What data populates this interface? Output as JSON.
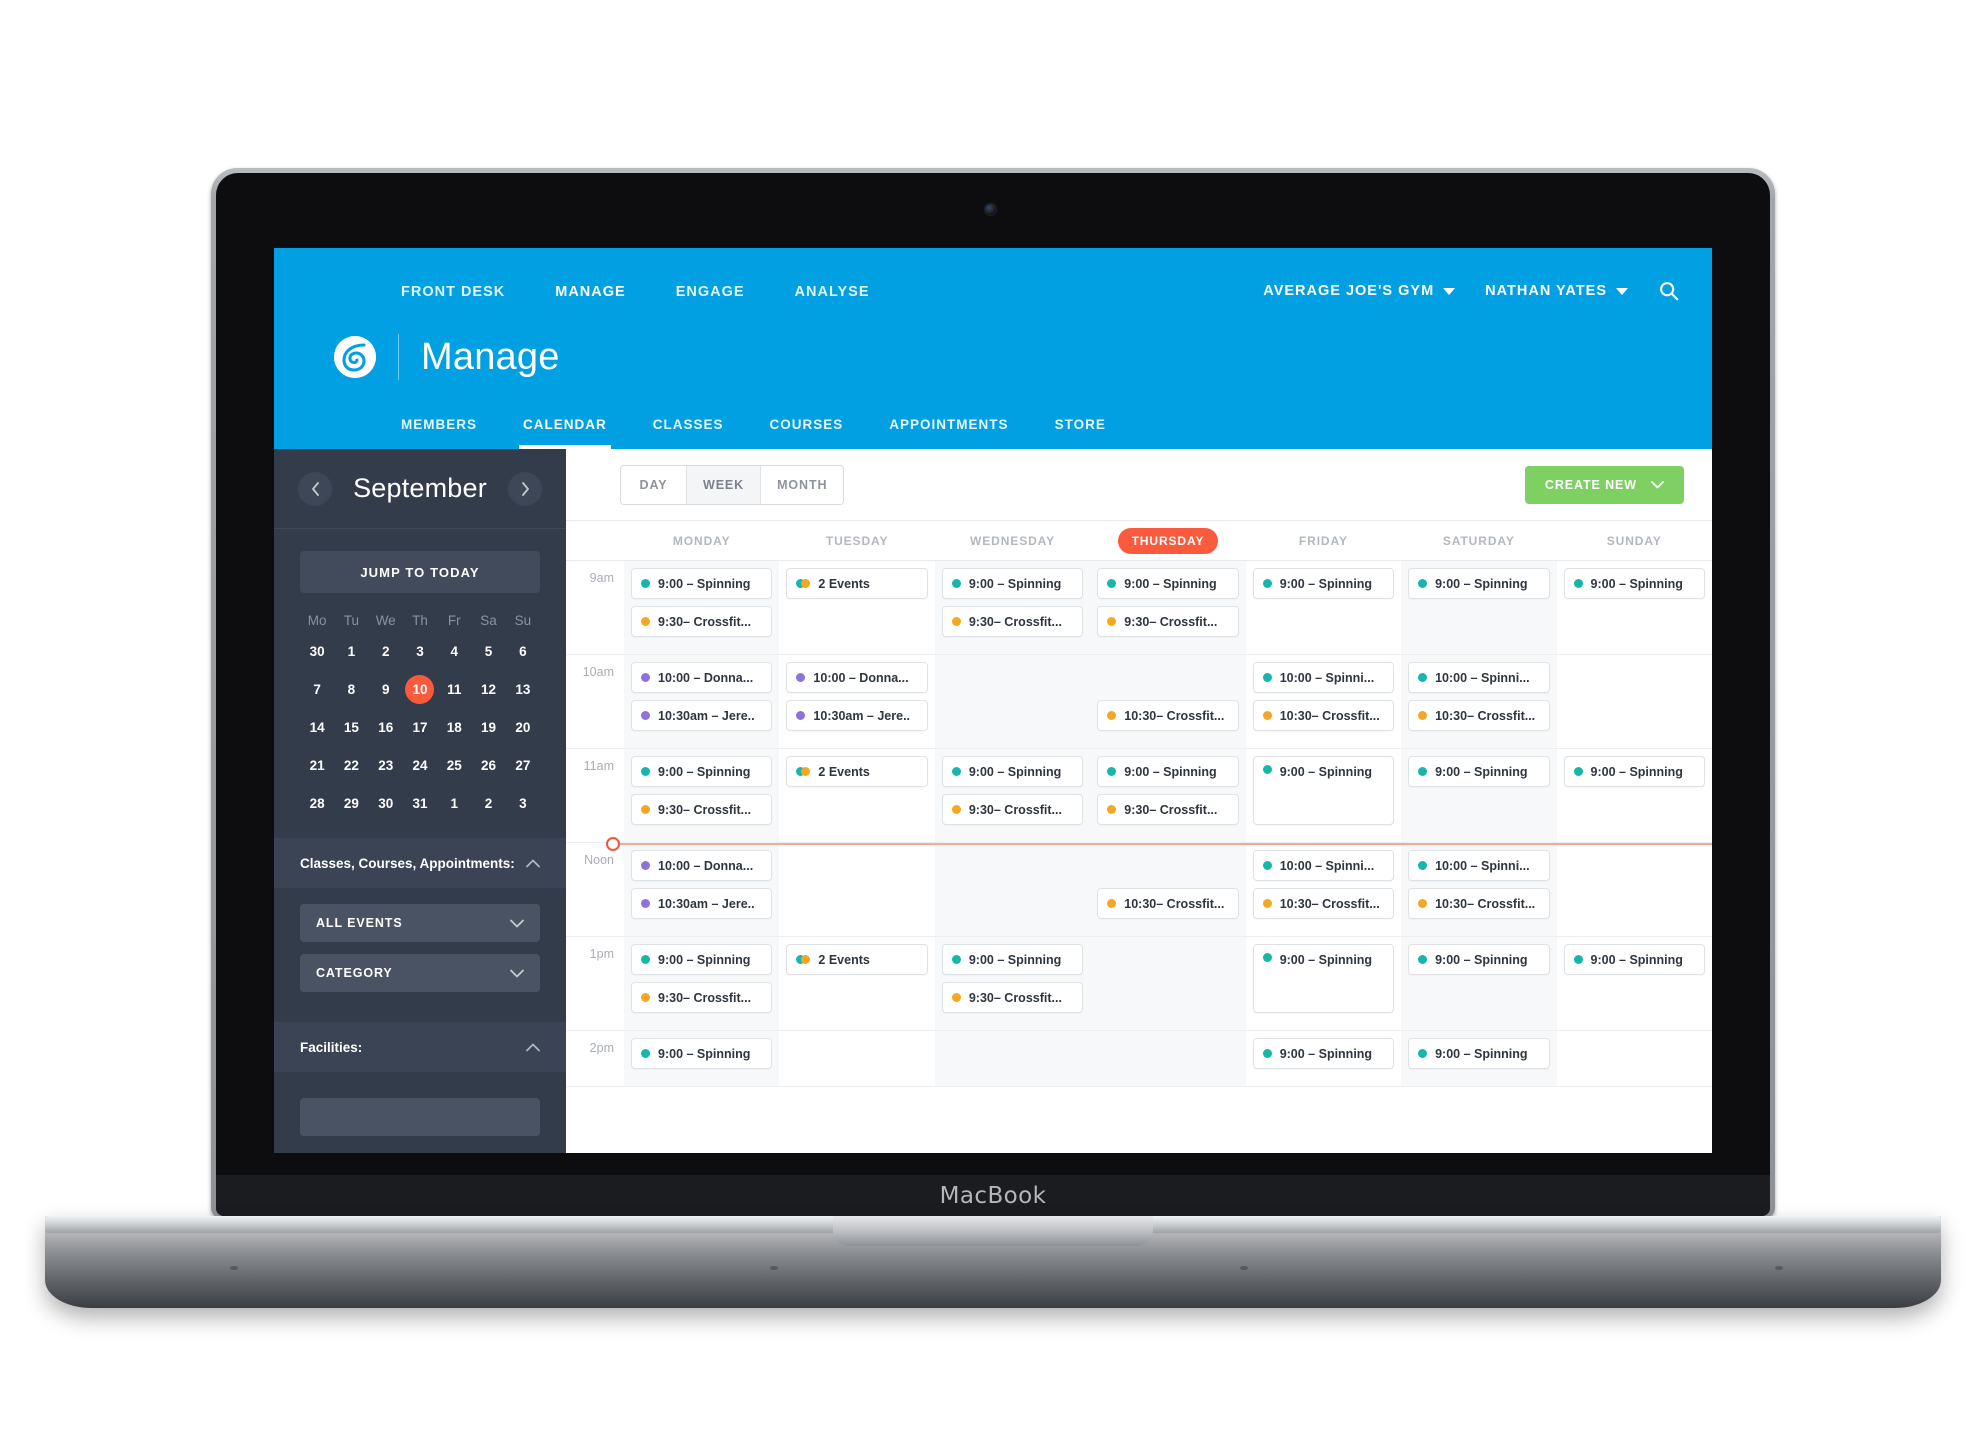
{
  "device": {
    "label": "MacBook"
  },
  "header": {
    "topnav": [
      {
        "label": "FRONT DESK",
        "active": false
      },
      {
        "label": "MANAGE",
        "active": true
      },
      {
        "label": "ENGAGE",
        "active": false
      },
      {
        "label": "ANALYSE",
        "active": false
      }
    ],
    "account": {
      "gym": "AVERAGE JOE'S GYM",
      "user": "NATHAN YATES"
    },
    "brand_title": "Manage",
    "subnav": [
      {
        "label": "MEMBERS",
        "active": false
      },
      {
        "label": "CALENDAR",
        "active": true
      },
      {
        "label": "CLASSES",
        "active": false
      },
      {
        "label": "COURSES",
        "active": false
      },
      {
        "label": "APPOINTMENTS",
        "active": false
      },
      {
        "label": "STORE",
        "active": false
      }
    ],
    "colors": {
      "brand_blue": "#00a0e3",
      "accent_orange": "#fb5a3c",
      "green": "#7ed063"
    }
  },
  "sidebar": {
    "month": "September",
    "jump_to_today": "JUMP TO TODAY",
    "weekday_initials": [
      "Mo",
      "Tu",
      "We",
      "Th",
      "Fr",
      "Sa",
      "Su"
    ],
    "weeks": [
      [
        "30",
        "1",
        "2",
        "3",
        "4",
        "5",
        "6"
      ],
      [
        "7",
        "8",
        "9",
        "10",
        "11",
        "12",
        "13"
      ],
      [
        "14",
        "15",
        "16",
        "17",
        "18",
        "19",
        "20"
      ],
      [
        "21",
        "22",
        "23",
        "24",
        "25",
        "26",
        "27"
      ],
      [
        "28",
        "29",
        "30",
        "31",
        "1",
        "2",
        "3"
      ]
    ],
    "today": "10",
    "filters": {
      "events_header": "Classes, Courses, Appointments:",
      "event_type_value": "ALL EVENTS",
      "category_value": "CATEGORY",
      "facilities_header": "Facilities:"
    }
  },
  "toolbar": {
    "views": [
      {
        "label": "DAY",
        "active": false
      },
      {
        "label": "WEEK",
        "active": true
      },
      {
        "label": "MONTH",
        "active": false
      }
    ],
    "create_label": "CREATE NEW"
  },
  "calendar": {
    "days": [
      {
        "label": "MONDAY",
        "selected": false
      },
      {
        "label": "TUESDAY",
        "selected": false
      },
      {
        "label": "WEDNESDAY",
        "selected": false
      },
      {
        "label": "THURSDAY",
        "selected": true
      },
      {
        "label": "FRIDAY",
        "selected": false
      },
      {
        "label": "SATURDAY",
        "selected": false
      },
      {
        "label": "SUNDAY",
        "selected": false
      }
    ],
    "spinning": "9:00 – Spinning",
    "crossfit": "9:30– Crossfit...",
    "two_events": "2 Events",
    "donna": "10:00 – Donna...",
    "jeremy": "10:30am – Jere..",
    "spinning10": "10:00 – Spinni...",
    "crossfit10": "10:30– Crossfit...",
    "rows": [
      {
        "hour": "9am",
        "cols": [
          [
            {
              "d": "teal",
              "t": "spinning"
            },
            {
              "d": "orange",
              "t": "crossfit"
            }
          ],
          [
            {
              "d": "two",
              "t": "two_events"
            }
          ],
          [
            {
              "d": "teal",
              "t": "spinning"
            },
            {
              "d": "orange",
              "t": "crossfit"
            }
          ],
          [
            {
              "d": "teal",
              "t": "spinning"
            },
            {
              "d": "orange",
              "t": "crossfit"
            }
          ],
          [
            {
              "d": "teal",
              "t": "spinning"
            }
          ],
          [
            {
              "d": "teal",
              "t": "spinning"
            }
          ],
          [
            {
              "d": "teal",
              "t": "spinning"
            }
          ]
        ]
      },
      {
        "hour": "10am",
        "cols": [
          [
            {
              "d": "purple",
              "t": "donna"
            },
            {
              "d": "purple",
              "t": "jeremy"
            }
          ],
          [
            {
              "d": "purple",
              "t": "donna"
            },
            {
              "d": "purple",
              "t": "jeremy"
            }
          ],
          [],
          [
            {
              "d": "orange",
              "t": "crossfit10",
              "offset": true
            }
          ],
          [
            {
              "d": "teal",
              "t": "spinning10"
            },
            {
              "d": "orange",
              "t": "crossfit10"
            }
          ],
          [
            {
              "d": "teal",
              "t": "spinning10"
            },
            {
              "d": "orange",
              "t": "crossfit10"
            }
          ],
          []
        ]
      },
      {
        "hour": "11am",
        "cols": [
          [
            {
              "d": "teal",
              "t": "spinning"
            },
            {
              "d": "orange",
              "t": "crossfit"
            }
          ],
          [
            {
              "d": "two",
              "t": "two_events"
            }
          ],
          [
            {
              "d": "teal",
              "t": "spinning"
            },
            {
              "d": "orange",
              "t": "crossfit"
            }
          ],
          [
            {
              "d": "teal",
              "t": "spinning"
            },
            {
              "d": "orange",
              "t": "crossfit"
            }
          ],
          [
            {
              "d": "teal",
              "t": "spinning",
              "tall": true
            }
          ],
          [
            {
              "d": "teal",
              "t": "spinning"
            }
          ],
          [
            {
              "d": "teal",
              "t": "spinning"
            }
          ]
        ]
      },
      {
        "hour": "Noon",
        "now_line": true,
        "cols": [
          [
            {
              "d": "purple",
              "t": "donna"
            },
            {
              "d": "purple",
              "t": "jeremy"
            }
          ],
          [],
          [],
          [
            {
              "d": "orange",
              "t": "crossfit10",
              "offset": true
            }
          ],
          [
            {
              "d": "teal",
              "t": "spinning10"
            },
            {
              "d": "orange",
              "t": "crossfit10"
            }
          ],
          [
            {
              "d": "teal",
              "t": "spinning10"
            },
            {
              "d": "orange",
              "t": "crossfit10"
            }
          ],
          []
        ]
      },
      {
        "hour": "1pm",
        "cols": [
          [
            {
              "d": "teal",
              "t": "spinning"
            },
            {
              "d": "orange",
              "t": "crossfit"
            }
          ],
          [
            {
              "d": "two",
              "t": "two_events"
            }
          ],
          [
            {
              "d": "teal",
              "t": "spinning"
            },
            {
              "d": "orange",
              "t": "crossfit"
            }
          ],
          [],
          [
            {
              "d": "teal",
              "t": "spinning",
              "tall": true
            }
          ],
          [
            {
              "d": "teal",
              "t": "spinning"
            }
          ],
          [
            {
              "d": "teal",
              "t": "spinning"
            }
          ]
        ]
      },
      {
        "hour": "2pm",
        "partial": true,
        "cols": [
          [
            {
              "d": "teal",
              "t": "spinning"
            }
          ],
          [],
          [],
          [],
          [
            {
              "d": "teal",
              "t": "spinning"
            }
          ],
          [
            {
              "d": "teal",
              "t": "spinning"
            }
          ],
          []
        ]
      }
    ]
  }
}
